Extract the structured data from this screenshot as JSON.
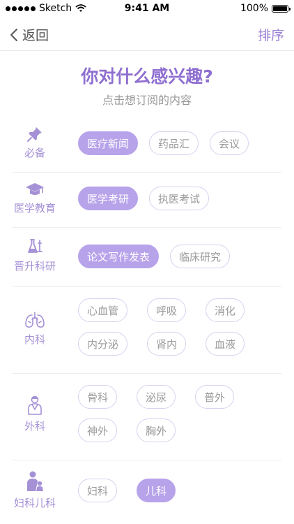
{
  "status_bar": {
    "carrier": "Sketch",
    "time": "9:41 AM",
    "battery": "100%",
    "battery_level": 1.0
  },
  "nav": {
    "back_label": "返回",
    "sort_label": "排序"
  },
  "header": {
    "title": "你对什么感兴趣?",
    "subtitle": "点击想订阅的内容"
  },
  "colors": {
    "accent": "#8f6fd0",
    "selected_tag": "#b7a3ea",
    "tag_border": "#d9d0ee"
  },
  "categories": [
    {
      "label": "必备",
      "icon": "pushpin-icon",
      "tags": [
        {
          "label": "医疗新闻",
          "selected": true
        },
        {
          "label": "药品汇",
          "selected": false
        },
        {
          "label": "会议",
          "selected": false
        }
      ]
    },
    {
      "label": "医学教育",
      "icon": "graduation-cap-icon",
      "tags": [
        {
          "label": "医学考研",
          "selected": true
        },
        {
          "label": "执医考试",
          "selected": false
        }
      ]
    },
    {
      "label": "晋升科研",
      "icon": "microscope-icon",
      "tags": [
        {
          "label": "论文写作发表",
          "selected": true
        },
        {
          "label": "临床研究",
          "selected": false
        }
      ]
    },
    {
      "label": "内科",
      "icon": "lungs-icon",
      "tags": [
        {
          "label": "心血管",
          "selected": false
        },
        {
          "label": "呼吸",
          "selected": false
        },
        {
          "label": "消化",
          "selected": false
        },
        {
          "label": "内分泌",
          "selected": false
        },
        {
          "label": "肾内",
          "selected": false
        },
        {
          "label": "血液",
          "selected": false
        }
      ]
    },
    {
      "label": "外科",
      "icon": "surgeon-icon",
      "tags": [
        {
          "label": "骨科",
          "selected": false
        },
        {
          "label": "泌尿",
          "selected": false
        },
        {
          "label": "普外",
          "selected": false
        },
        {
          "label": "神外",
          "selected": false
        },
        {
          "label": "胸外",
          "selected": false
        }
      ]
    },
    {
      "label": "妇科儿科",
      "icon": "mother-child-icon",
      "tags": [
        {
          "label": "妇科",
          "selected": false
        },
        {
          "label": "儿科",
          "selected": true
        }
      ]
    }
  ]
}
